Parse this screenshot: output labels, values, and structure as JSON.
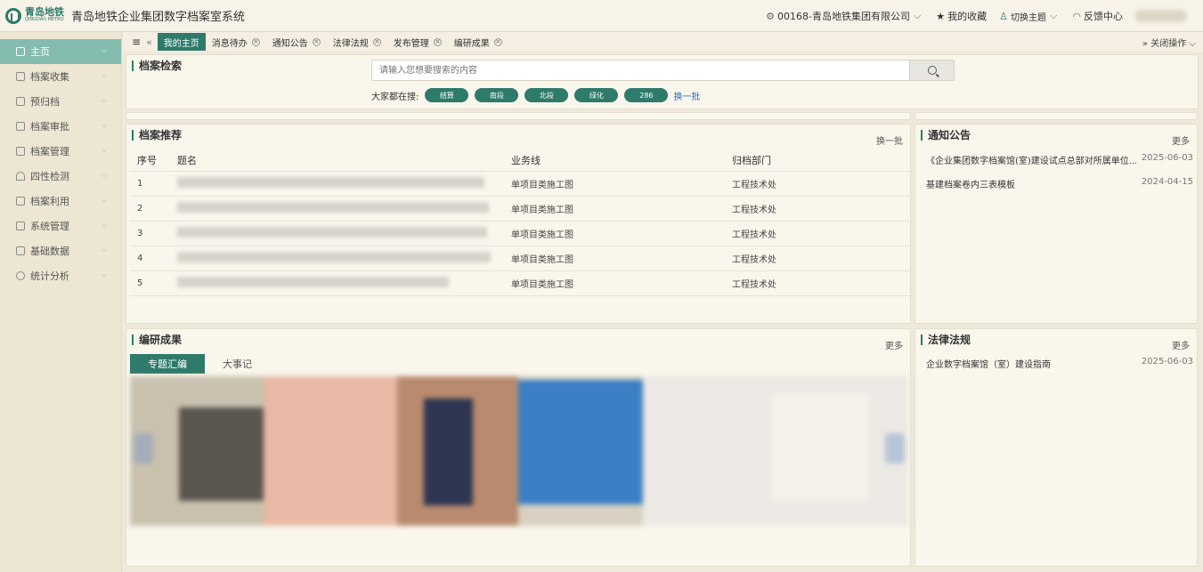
{
  "header": {
    "logo_cn": "青岛地铁",
    "logo_en": "QINGDAO METRO",
    "system_title": "青岛地铁企业集团数字档案室系统",
    "org_selector": "00168-青岛地铁集团有限公司",
    "favorites": "我的收藏",
    "switch_theme": "切换主题",
    "feedback": "反馈中心"
  },
  "sidebar": {
    "items": [
      {
        "label": "主页",
        "icon": "home-icon"
      },
      {
        "label": "档案收集",
        "icon": "folder-add-icon"
      },
      {
        "label": "预归档",
        "icon": "folder-icon"
      },
      {
        "label": "档案审批",
        "icon": "approve-icon"
      },
      {
        "label": "档案管理",
        "icon": "manage-icon"
      },
      {
        "label": "四性检测",
        "icon": "umbrella-icon"
      },
      {
        "label": "档案利用",
        "icon": "share-icon"
      },
      {
        "label": "系统管理",
        "icon": "bag-icon"
      },
      {
        "label": "基础数据",
        "icon": "database-icon"
      },
      {
        "label": "统计分析",
        "icon": "pie-icon"
      }
    ]
  },
  "tabs": {
    "items": [
      "我的主页",
      "消息待办",
      "通知公告",
      "法律法规",
      "发布管理",
      "编研成果"
    ],
    "close_ops": "关闭操作"
  },
  "search": {
    "title": "档案检索",
    "placeholder": "请输入您想要搜索的内容",
    "hot_label": "大家都在搜:",
    "hot_tags": [
      "结算",
      "南段",
      "北段",
      "绿化",
      "286"
    ],
    "refresh": "换一批"
  },
  "recommend": {
    "title": "档案推荐",
    "refresh": "换一批",
    "columns": [
      "序号",
      "题名",
      "业务线",
      "归档部门"
    ],
    "rows": [
      {
        "no": "1",
        "line": "单项目类施工图",
        "dept": "工程技术处"
      },
      {
        "no": "2",
        "line": "单项目类施工图",
        "dept": "工程技术处"
      },
      {
        "no": "3",
        "line": "单项目类施工图",
        "dept": "工程技术处"
      },
      {
        "no": "4",
        "line": "单项目类施工图",
        "dept": "工程技术处"
      },
      {
        "no": "5",
        "line": "单项目类施工图",
        "dept": "工程技术处"
      }
    ]
  },
  "notice": {
    "title": "通知公告",
    "more": "更多",
    "items": [
      {
        "text": "《企业集团数字档案馆(室)建设试点总部对所属单位...",
        "date": "2025-06-03"
      },
      {
        "text": "基建档案卷内三表模板",
        "date": "2024-04-15"
      }
    ]
  },
  "research": {
    "title": "编研成果",
    "more": "更多",
    "subtabs": [
      "专题汇编",
      "大事记"
    ]
  },
  "laws": {
    "title": "法律法规",
    "more": "更多",
    "items": [
      {
        "text": "企业数字档案馆（室）建设指南",
        "date": "2025-06-03"
      }
    ]
  },
  "colors": {
    "accent": "#2e7a6b",
    "sidebar_active": "#84bdb0",
    "link": "#2c6fb5"
  }
}
